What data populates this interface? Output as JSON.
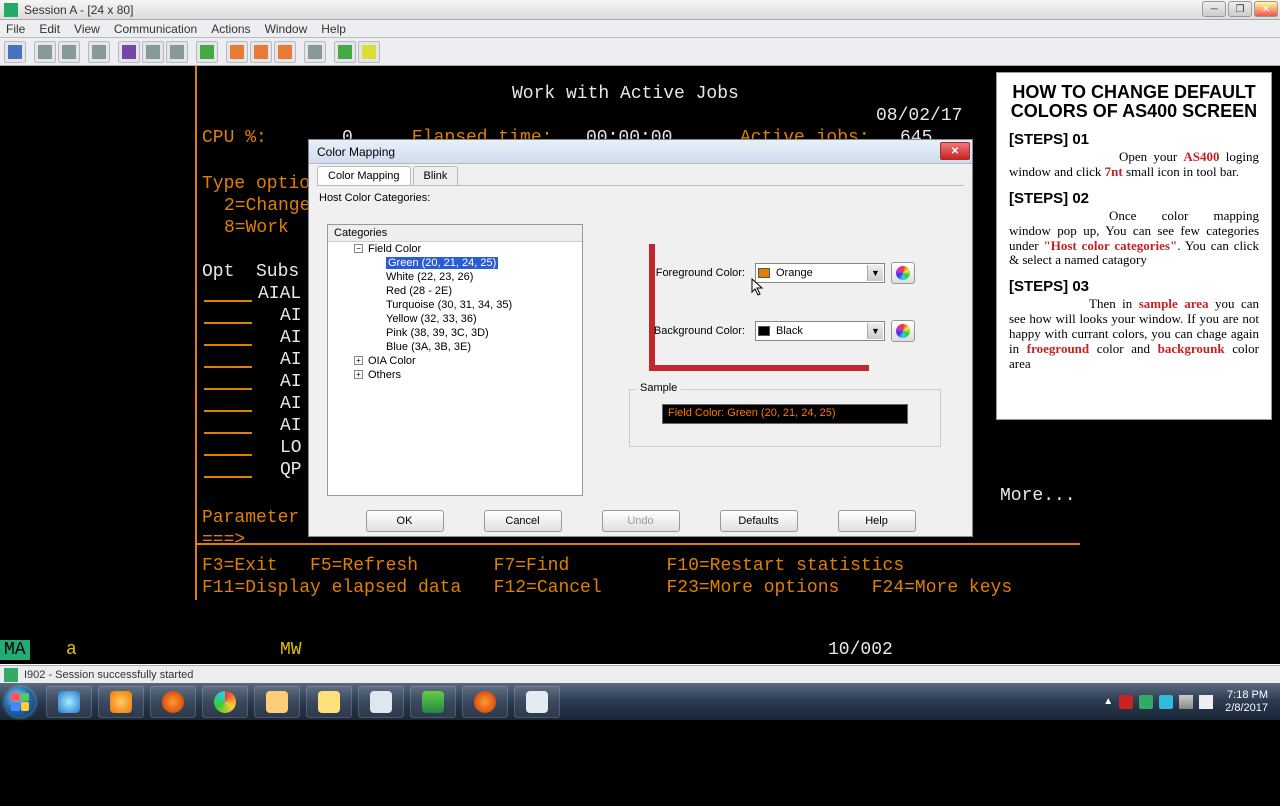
{
  "window": {
    "title": "Session A - [24 x 80]"
  },
  "menu": [
    "File",
    "Edit",
    "View",
    "Communication",
    "Actions",
    "Window",
    "Help"
  ],
  "terminal": {
    "title": "Work with Active Jobs",
    "date": "08/02/17",
    "cpu_label": "CPU %:",
    "cpu_value": "0",
    "elapsed_label": "Elapsed time:",
    "elapsed_value": "00:00:00",
    "active_label": "Active jobs:",
    "active_value": "645",
    "type_opts": "Type optio",
    "opt_change": "2=Change",
    "opt_work": "8=Work ",
    "opt_header": "Opt  Subs",
    "sub1": "AIAL",
    "subs": [
      "AI",
      "AI",
      "AI",
      "AI",
      "AI",
      "AI",
      "LO",
      "QP"
    ],
    "params_label": "Parameter",
    "prompt": "===>",
    "more": "More...",
    "fkeys1": "F3=Exit   F5=Refresh       F7=Find         F10=Restart statistics",
    "fkeys2": "F11=Display elapsed data   F12=Cancel      F23=More options   F24=More keys"
  },
  "status": {
    "ma": "MA",
    "a": "a",
    "mw": "MW",
    "coord": "10/002"
  },
  "app_status": "I902 - Session successfully started",
  "dialog": {
    "title": "Color Mapping",
    "tabs": [
      "Color Mapping",
      "Blink"
    ],
    "section": "Host Color Categories:",
    "tree_hdr": "Categories",
    "root": "Field Color",
    "items": [
      "Green (20, 21, 24, 25)",
      "White (22, 23, 26)",
      "Red (28 - 2E)",
      "Turquoise (30, 31, 34, 35)",
      "Yellow (32, 33, 36)",
      "Pink (38, 39, 3C, 3D)",
      "Blue (3A, 3B, 3E)"
    ],
    "oia": "OIA Color",
    "others": "Others",
    "fg_label": "Foreground Color:",
    "fg_value": "Orange",
    "bg_label": "Background Color:",
    "bg_value": "Black",
    "sample_label": "Sample",
    "sample_text": "Field Color: Green (20, 21, 24, 25)",
    "buttons": {
      "ok": "OK",
      "cancel": "Cancel",
      "undo": "Undo",
      "defaults": "Defaults",
      "help": "Help"
    }
  },
  "instr": {
    "title1": "HOW TO CHANGE DEFAULT",
    "title2": "COLORS OF AS400 SCREEN",
    "s1": "[STEPS] 01",
    "p1a": "Open your ",
    "p1b": "AS400",
    "p1c": " loging window and click ",
    "p1d": "7nt",
    "p1e": " small icon in tool bar.",
    "s2": "[STEPS] 02",
    "p2a": "Once color mapping window pop up, You can see few categories under ",
    "p2b": "\"Host color categories\"",
    "p2c": ". You can click & select a named catagory",
    "s3": "[STEPS] 03",
    "p3a": "Then in ",
    "p3b": "sample area",
    "p3c": " you can see how will looks your window. If you are not happy with currant colors, you can chage again in ",
    "p3d": "froeground",
    "p3e": " color and ",
    "p3f": "backgrounk",
    "p3g": " color area"
  },
  "clock": {
    "time": "7:18 PM",
    "date": "2/8/2017"
  }
}
